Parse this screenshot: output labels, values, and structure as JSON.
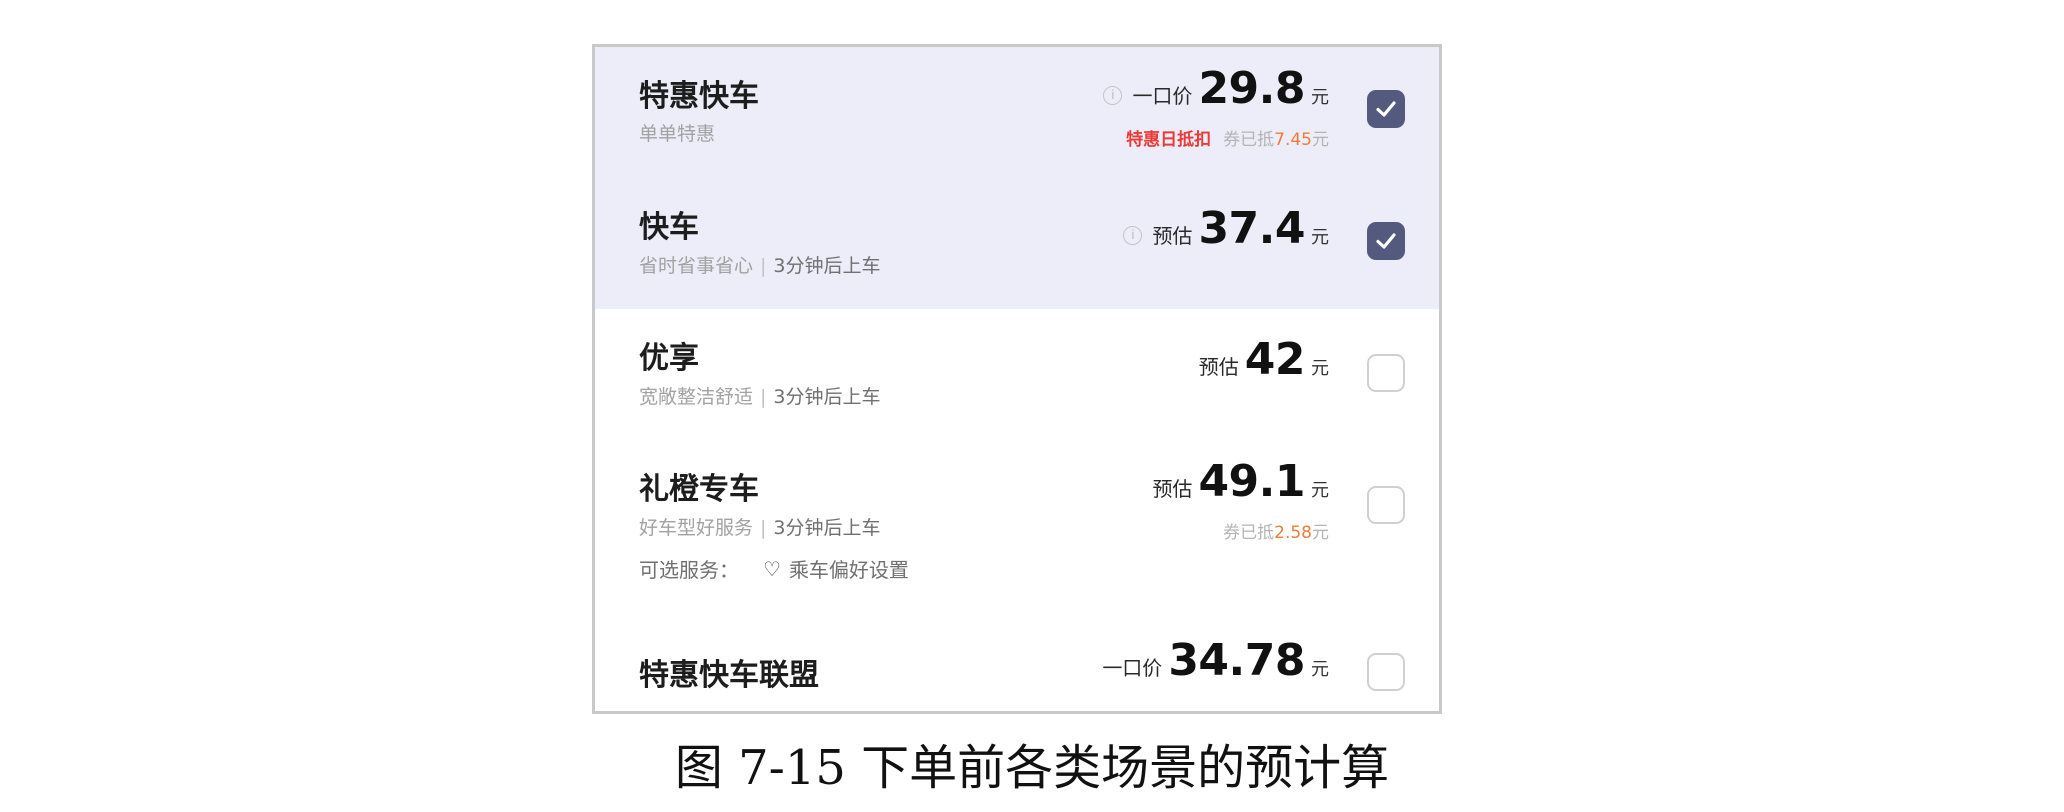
{
  "options": [
    {
      "name": "特惠快车",
      "desc": "单单特惠",
      "wait": "",
      "price_prefix": "一口价",
      "price": "29.8",
      "unit": "元",
      "note_tag": "特惠日抵扣",
      "note_text": "券已抵",
      "note_amount": "7.45",
      "note_unit": "元",
      "checked": true
    },
    {
      "name": "快车",
      "desc": "省时省事省心",
      "wait": "3分钟后上车",
      "price_prefix": "预估",
      "price": "37.4",
      "unit": "元",
      "checked": true
    },
    {
      "name": "优享",
      "desc": "宽敞整洁舒适",
      "wait": "3分钟后上车",
      "price_prefix": "预估",
      "price": "42",
      "unit": "元",
      "checked": false
    },
    {
      "name": "礼橙专车",
      "desc": "好车型好服务",
      "wait": "3分钟后上车",
      "price_prefix": "预估",
      "price": "49.1",
      "unit": "元",
      "note_text": "券已抵",
      "note_amount": "2.58",
      "note_unit": "元",
      "services_label": "可选服务：",
      "services_item": "乘车偏好设置",
      "checked": false
    },
    {
      "name": "特惠快车联盟",
      "price_prefix": "一口价",
      "price": "34.78",
      "unit": "元",
      "checked": false
    }
  ],
  "colors": {
    "selected_bg": "#ecedf8",
    "checkbox_on": "#545a7d",
    "discount_red": "#ea3b39",
    "discount_orange": "#f07b3a"
  },
  "icons": [
    "info-icon",
    "check-icon",
    "heart-icon"
  ],
  "caption": "图 7-15 下单前各类场景的预计算"
}
